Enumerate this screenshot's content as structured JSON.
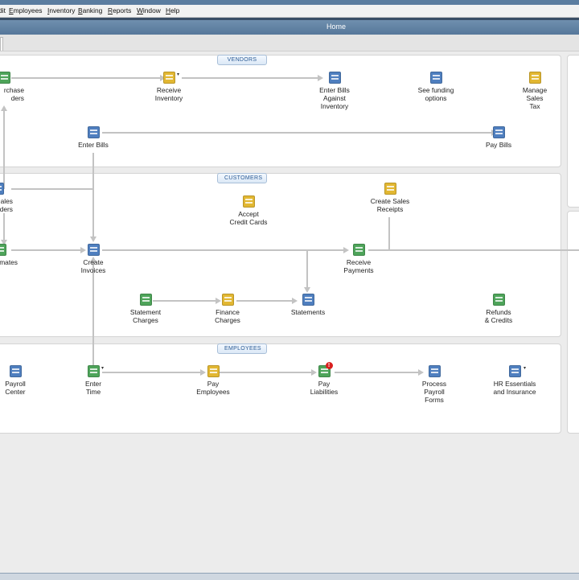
{
  "menu": [
    "Edit",
    "Employees",
    "Inventory",
    "Banking",
    "Reports",
    "Window",
    "Help"
  ],
  "window_title": "Home",
  "sections": {
    "vendors": "VENDORS",
    "customers": "CUSTOMERS",
    "employees": "EMPLOYEES"
  },
  "vendors": {
    "purchase_orders": "rchase\nders",
    "receive_inventory": "Receive\nInventory",
    "enter_bills_against_inventory": "Enter Bills\nAgainst\nInventory",
    "see_funding_options": "See funding\noptions",
    "manage_sales_tax": "Manage\nSales\nTax",
    "enter_bills": "Enter Bills",
    "pay_bills": "Pay Bills"
  },
  "customers": {
    "sales_orders": "ales\nders",
    "accept_credit_cards": "Accept\nCredit Cards",
    "create_sales_receipts": "Create Sales\nReceipts",
    "estimates": "mates",
    "create_invoices": "Create\nInvoices",
    "receive_payments": "Receive\nPayments",
    "statement_charges": "Statement\nCharges",
    "finance_charges": "Finance\nCharges",
    "statements": "Statements",
    "refunds_credits": "Refunds\n& Credits"
  },
  "employees": {
    "payroll_center": "Payroll\nCenter",
    "enter_time": "Enter\nTime",
    "pay_employees": "Pay\nEmployees",
    "pay_liabilities": "Pay\nLiabilities",
    "pay_liabilities_badge": "!",
    "process_payroll_forms": "Process\nPayroll\nForms",
    "hr_essentials": "HR Essentials\nand Insurance"
  },
  "dropdown_arrow": "▾",
  "icon_colors": {
    "green": "#4ea45a",
    "yellow": "#e2b732",
    "blue": "#4f7fbf",
    "red": "#d91f1f"
  }
}
